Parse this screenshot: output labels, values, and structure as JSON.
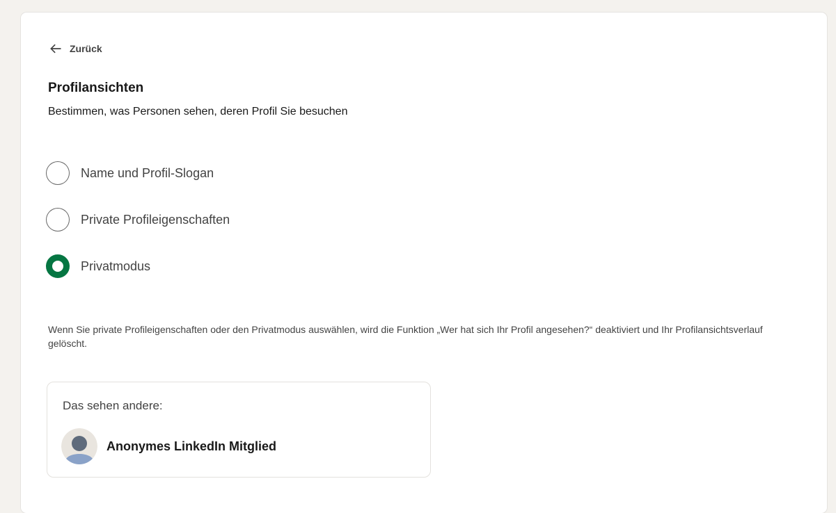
{
  "back": {
    "label": "Zurück",
    "icon": "arrow-left-icon"
  },
  "section": {
    "title": "Profilansichten",
    "subtitle": "Bestimmen, was Personen sehen, deren Profil Sie besuchen"
  },
  "options": [
    {
      "label": "Name und Profil-Slogan",
      "selected": false
    },
    {
      "label": "Private Profileigenschaften",
      "selected": false
    },
    {
      "label": "Privatmodus",
      "selected": true
    }
  ],
  "notice": "Wenn Sie private Profileigenschaften oder den Privatmodus auswählen, wird die Funktion „Wer hat sich Ihr Profil angesehen?“ deaktiviert und Ihr Profilansichtsverlauf gelöscht.",
  "preview": {
    "heading": "Das sehen andere:",
    "avatar_icon": "anonymous-avatar-icon",
    "member_name": "Anonymes LinkedIn Mitglied"
  },
  "colors": {
    "accent": "#057642",
    "page_background": "#f4f2ee",
    "card_background": "#ffffff"
  }
}
